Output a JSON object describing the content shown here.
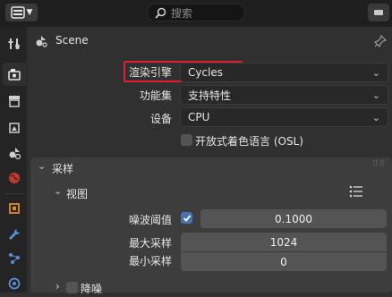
{
  "header": {
    "search_placeholder": "搜索"
  },
  "scene": {
    "title": "Scene"
  },
  "render": {
    "engine_label": "渲染引擎",
    "engine_value": "Cycles",
    "feature_set_label": "功能集",
    "feature_set_value": "支持特性",
    "device_label": "设备",
    "device_value": "CPU",
    "osl_label": "开放式着色语言 (OSL)",
    "osl_checked": false
  },
  "sampling": {
    "title": "采样",
    "viewport": {
      "title": "视图",
      "noise_threshold_label": "噪波阈值",
      "noise_threshold_enabled": true,
      "noise_threshold_value": "0.1000",
      "max_samples_label": "最大采样",
      "max_samples_value": "1024",
      "min_samples_label": "最小采样",
      "min_samples_value": "0"
    },
    "denoise": {
      "title": "降噪"
    }
  },
  "colors": {
    "highlight": "#e0202e",
    "accent": "#4772b3"
  }
}
